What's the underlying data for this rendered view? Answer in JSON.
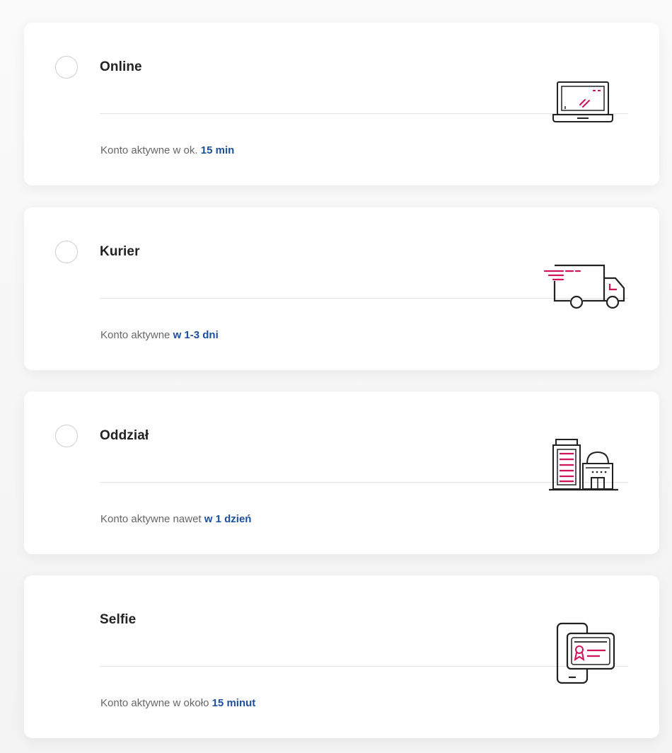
{
  "options": [
    {
      "title": "Online",
      "desc_prefix": "Konto aktywne w ok. ",
      "desc_highlight": "15 min",
      "icon": "laptop-icon",
      "has_radio": true
    },
    {
      "title": "Kurier",
      "desc_prefix": "Konto aktywne ",
      "desc_highlight": "w 1-3 dni",
      "icon": "delivery-truck-icon",
      "has_radio": true
    },
    {
      "title": "Oddział",
      "desc_prefix": "Konto aktywne nawet ",
      "desc_highlight": "w 1 dzień",
      "icon": "bank-branch-icon",
      "has_radio": true
    },
    {
      "title": "Selfie",
      "desc_prefix": "Konto aktywne w około ",
      "desc_highlight": "15 minut",
      "icon": "phone-id-card-icon",
      "has_radio": false
    }
  ],
  "colors": {
    "accent_highlight": "#1b4f9c",
    "icon_accent": "#d1145a",
    "icon_stroke": "#222222"
  }
}
